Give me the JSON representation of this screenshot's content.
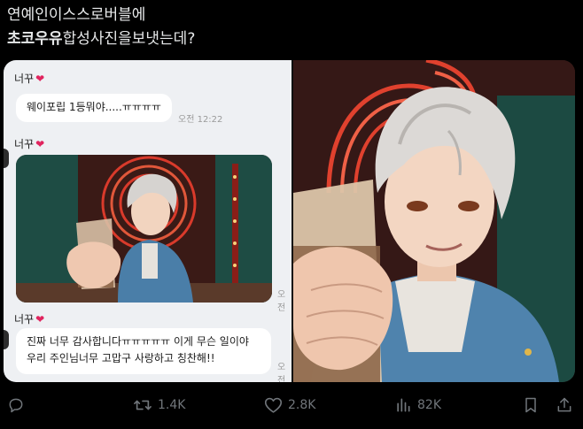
{
  "tweet": {
    "line1": "연예인이스스로버블에",
    "line2_bold": "초코우유",
    "line2_rest": "합성사진을보냇는데?"
  },
  "chat": {
    "sender_name": "너꾸",
    "msg1": "웨이포립 1등뭐야.....ㅠㅠㅠㅠ",
    "msg1_time": "오전 12:22",
    "photo_time": "오전",
    "msg3": "진짜 너무 감사합니다ㅠㅠㅠㅠㅠ 이게 무슨 일이야 우리 주인님너무 고맙구 사랑하고 칭찬해!!",
    "msg3_time": "오전"
  },
  "actions": {
    "reply_count": "",
    "retweet_count": "1.4K",
    "like_count": "2.8K",
    "view_count": "82K"
  },
  "colors": {
    "background": "#000000",
    "text": "#e7e9ea",
    "muted": "#71767b",
    "heart": "#e0245e"
  }
}
